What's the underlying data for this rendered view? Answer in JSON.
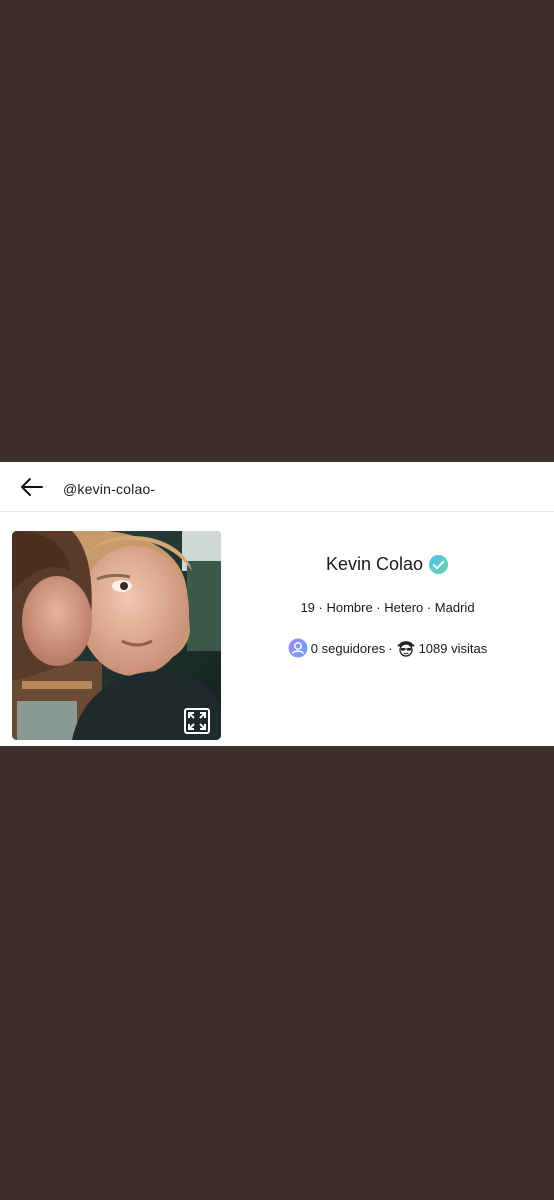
{
  "header": {
    "username": "@kevin-colao-",
    "back_icon": "arrow-left-icon"
  },
  "profile": {
    "name": "Kevin Colao",
    "verified_icon": "verified-check-icon",
    "details": "19 · Hombre · Hetero · Madrid",
    "followers_text": "0 seguidores",
    "separator": "·",
    "visits_text": "1089 visitas",
    "followers_icon": "user-icon",
    "visits_icon": "spy-icon",
    "expand_icon": "expand-icon",
    "photo": "profile-photo"
  },
  "colors": {
    "background": "#3c2e2b",
    "card": "#ffffff",
    "verified_start": "#4fc3f7",
    "verified_end": "#66d19e",
    "followers_icon_start": "#a78bfa",
    "followers_icon_end": "#60a5fa"
  }
}
